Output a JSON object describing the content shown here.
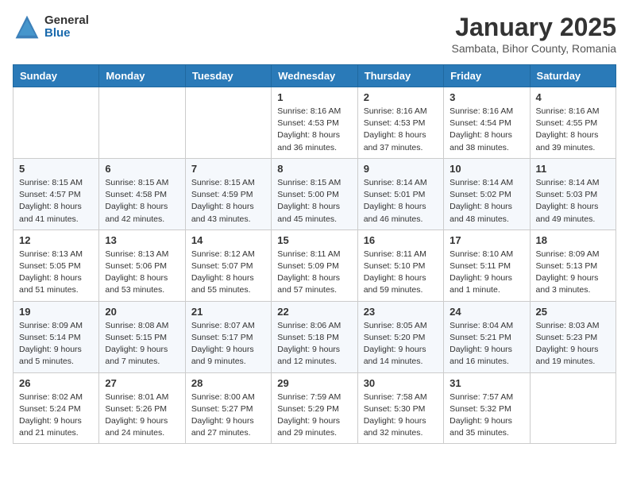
{
  "logo": {
    "general": "General",
    "blue": "Blue"
  },
  "header": {
    "title": "January 2025",
    "subtitle": "Sambata, Bihor County, Romania"
  },
  "weekdays": [
    "Sunday",
    "Monday",
    "Tuesday",
    "Wednesday",
    "Thursday",
    "Friday",
    "Saturday"
  ],
  "weeks": [
    [
      {
        "day": "",
        "text": ""
      },
      {
        "day": "",
        "text": ""
      },
      {
        "day": "",
        "text": ""
      },
      {
        "day": "1",
        "text": "Sunrise: 8:16 AM\nSunset: 4:53 PM\nDaylight: 8 hours and 36 minutes."
      },
      {
        "day": "2",
        "text": "Sunrise: 8:16 AM\nSunset: 4:53 PM\nDaylight: 8 hours and 37 minutes."
      },
      {
        "day": "3",
        "text": "Sunrise: 8:16 AM\nSunset: 4:54 PM\nDaylight: 8 hours and 38 minutes."
      },
      {
        "day": "4",
        "text": "Sunrise: 8:16 AM\nSunset: 4:55 PM\nDaylight: 8 hours and 39 minutes."
      }
    ],
    [
      {
        "day": "5",
        "text": "Sunrise: 8:15 AM\nSunset: 4:57 PM\nDaylight: 8 hours and 41 minutes."
      },
      {
        "day": "6",
        "text": "Sunrise: 8:15 AM\nSunset: 4:58 PM\nDaylight: 8 hours and 42 minutes."
      },
      {
        "day": "7",
        "text": "Sunrise: 8:15 AM\nSunset: 4:59 PM\nDaylight: 8 hours and 43 minutes."
      },
      {
        "day": "8",
        "text": "Sunrise: 8:15 AM\nSunset: 5:00 PM\nDaylight: 8 hours and 45 minutes."
      },
      {
        "day": "9",
        "text": "Sunrise: 8:14 AM\nSunset: 5:01 PM\nDaylight: 8 hours and 46 minutes."
      },
      {
        "day": "10",
        "text": "Sunrise: 8:14 AM\nSunset: 5:02 PM\nDaylight: 8 hours and 48 minutes."
      },
      {
        "day": "11",
        "text": "Sunrise: 8:14 AM\nSunset: 5:03 PM\nDaylight: 8 hours and 49 minutes."
      }
    ],
    [
      {
        "day": "12",
        "text": "Sunrise: 8:13 AM\nSunset: 5:05 PM\nDaylight: 8 hours and 51 minutes."
      },
      {
        "day": "13",
        "text": "Sunrise: 8:13 AM\nSunset: 5:06 PM\nDaylight: 8 hours and 53 minutes."
      },
      {
        "day": "14",
        "text": "Sunrise: 8:12 AM\nSunset: 5:07 PM\nDaylight: 8 hours and 55 minutes."
      },
      {
        "day": "15",
        "text": "Sunrise: 8:11 AM\nSunset: 5:09 PM\nDaylight: 8 hours and 57 minutes."
      },
      {
        "day": "16",
        "text": "Sunrise: 8:11 AM\nSunset: 5:10 PM\nDaylight: 8 hours and 59 minutes."
      },
      {
        "day": "17",
        "text": "Sunrise: 8:10 AM\nSunset: 5:11 PM\nDaylight: 9 hours and 1 minute."
      },
      {
        "day": "18",
        "text": "Sunrise: 8:09 AM\nSunset: 5:13 PM\nDaylight: 9 hours and 3 minutes."
      }
    ],
    [
      {
        "day": "19",
        "text": "Sunrise: 8:09 AM\nSunset: 5:14 PM\nDaylight: 9 hours and 5 minutes."
      },
      {
        "day": "20",
        "text": "Sunrise: 8:08 AM\nSunset: 5:15 PM\nDaylight: 9 hours and 7 minutes."
      },
      {
        "day": "21",
        "text": "Sunrise: 8:07 AM\nSunset: 5:17 PM\nDaylight: 9 hours and 9 minutes."
      },
      {
        "day": "22",
        "text": "Sunrise: 8:06 AM\nSunset: 5:18 PM\nDaylight: 9 hours and 12 minutes."
      },
      {
        "day": "23",
        "text": "Sunrise: 8:05 AM\nSunset: 5:20 PM\nDaylight: 9 hours and 14 minutes."
      },
      {
        "day": "24",
        "text": "Sunrise: 8:04 AM\nSunset: 5:21 PM\nDaylight: 9 hours and 16 minutes."
      },
      {
        "day": "25",
        "text": "Sunrise: 8:03 AM\nSunset: 5:23 PM\nDaylight: 9 hours and 19 minutes."
      }
    ],
    [
      {
        "day": "26",
        "text": "Sunrise: 8:02 AM\nSunset: 5:24 PM\nDaylight: 9 hours and 21 minutes."
      },
      {
        "day": "27",
        "text": "Sunrise: 8:01 AM\nSunset: 5:26 PM\nDaylight: 9 hours and 24 minutes."
      },
      {
        "day": "28",
        "text": "Sunrise: 8:00 AM\nSunset: 5:27 PM\nDaylight: 9 hours and 27 minutes."
      },
      {
        "day": "29",
        "text": "Sunrise: 7:59 AM\nSunset: 5:29 PM\nDaylight: 9 hours and 29 minutes."
      },
      {
        "day": "30",
        "text": "Sunrise: 7:58 AM\nSunset: 5:30 PM\nDaylight: 9 hours and 32 minutes."
      },
      {
        "day": "31",
        "text": "Sunrise: 7:57 AM\nSunset: 5:32 PM\nDaylight: 9 hours and 35 minutes."
      },
      {
        "day": "",
        "text": ""
      }
    ]
  ]
}
